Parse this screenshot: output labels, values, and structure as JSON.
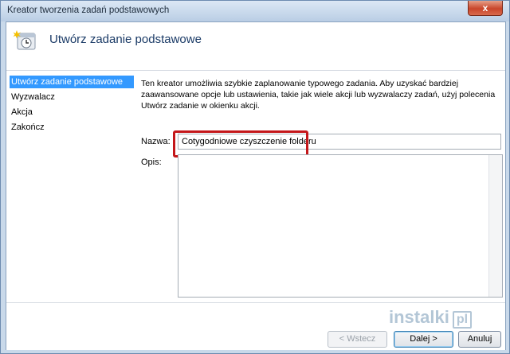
{
  "window": {
    "title": "Kreator tworzenia zadań podstawowych",
    "close_glyph": "x"
  },
  "header": {
    "title": "Utwórz zadanie podstawowe",
    "icon": "task-scheduler-icon"
  },
  "sidebar": {
    "items": [
      {
        "label": "Utwórz zadanie podstawowe",
        "active": true
      },
      {
        "label": "Wyzwalacz",
        "active": false
      },
      {
        "label": "Akcja",
        "active": false
      },
      {
        "label": "Zakończ",
        "active": false
      }
    ]
  },
  "main": {
    "description": "Ten kreator umożliwia szybkie zaplanowanie typowego zadania. Aby uzyskać bardziej zaawansowane opcje lub ustawienia, takie jak wiele akcji lub wyzwalaczy zadań, użyj polecenia Utwórz zadanie w okienku akcji.",
    "name_label": "Nazwa:",
    "name_value": "Cotygodniowe czyszczenie folderu",
    "desc_label": "Opis:",
    "desc_value": ""
  },
  "footer": {
    "back_label": "< Wstecz",
    "next_label": "Dalej >",
    "cancel_label": "Anuluj"
  },
  "watermark": {
    "text": "instalki",
    "box": "pl"
  },
  "colors": {
    "accent": "#3399ff",
    "highlight": "#c4171a"
  }
}
